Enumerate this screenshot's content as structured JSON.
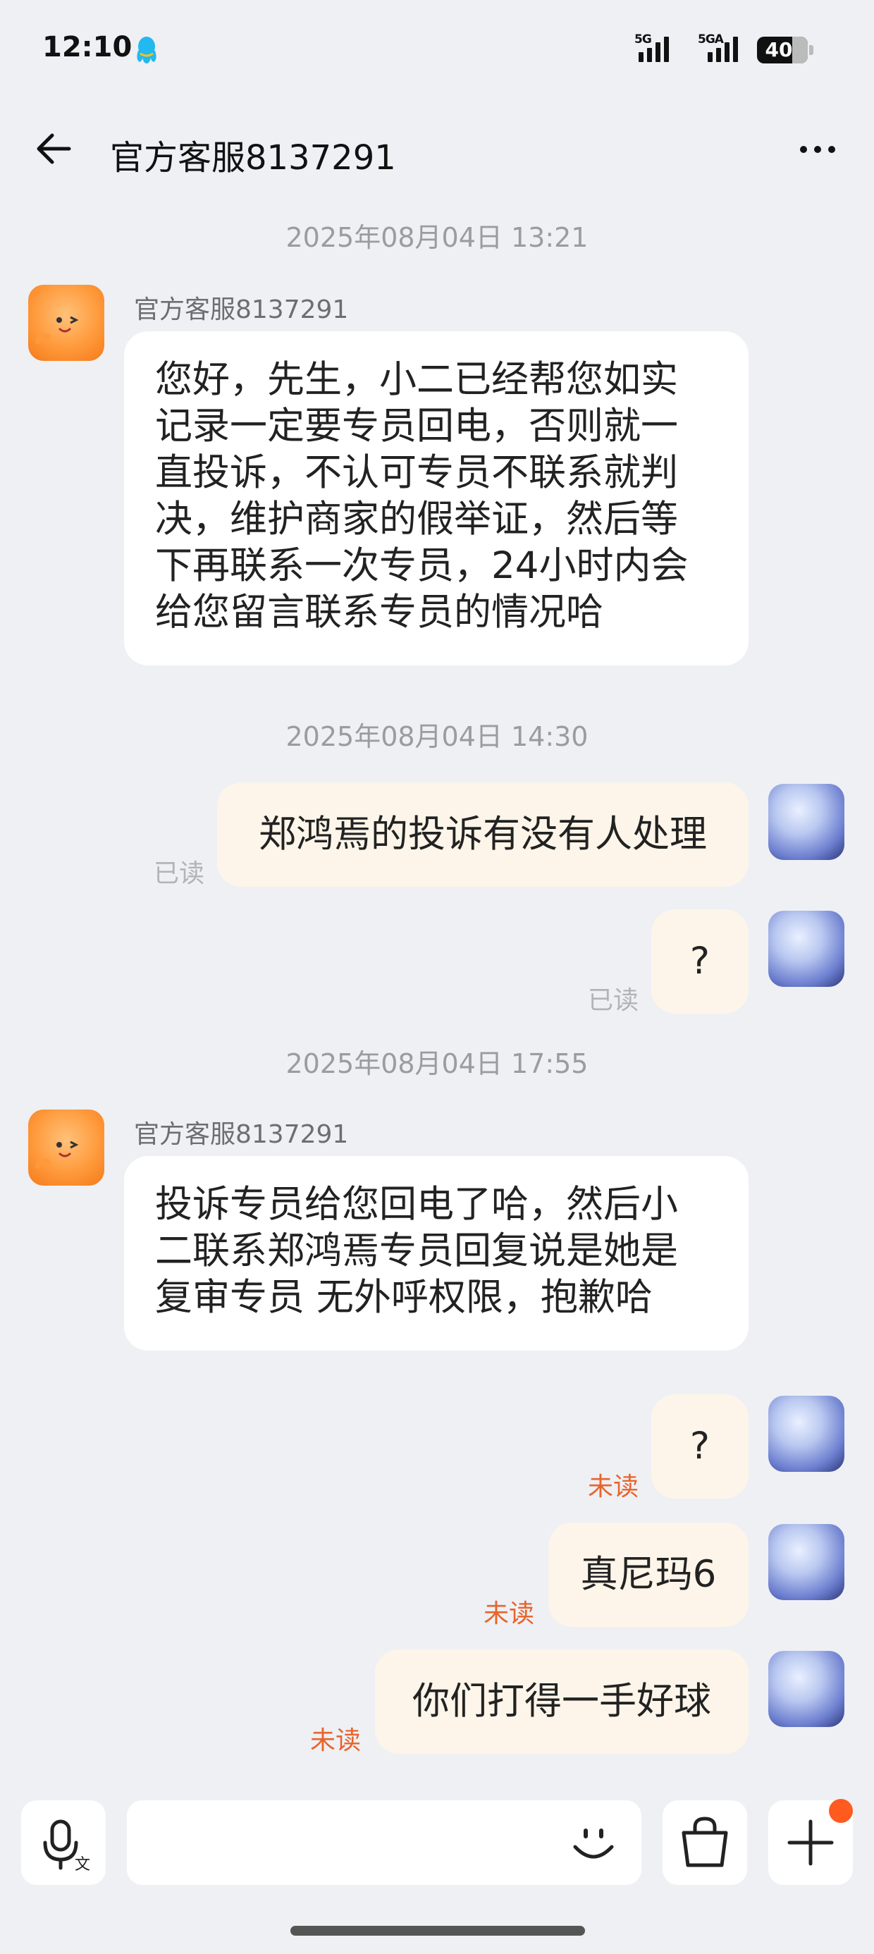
{
  "status_bar": {
    "time": "12:10",
    "signal1_label": "5G",
    "signal2_label": "5GA",
    "battery": "40",
    "icons": [
      "qq-icon",
      "signal-icon",
      "signal-icon",
      "battery-icon"
    ]
  },
  "header": {
    "title": "官方客服8137291",
    "icons": [
      "back-arrow-icon",
      "more-icon"
    ]
  },
  "messages": [
    {
      "type": "timestamp",
      "text": "2025年08月04日 13:21"
    },
    {
      "type": "incoming",
      "sender": "官方客服8137291",
      "lines": [
        "您好，先生，小二已经帮您如实",
        "记录一定要专员回电，否则就一",
        "直投诉，不认可专员不联系就判",
        "决，维护商家的假举证，然后等",
        "下再联系一次专员，24小时内会",
        "给您留言联系专员的情况哈"
      ]
    },
    {
      "type": "timestamp",
      "text": "2025年08月04日 14:30"
    },
    {
      "type": "outgoing",
      "text": "郑鸿焉的投诉有没有人处理",
      "status": "已读"
    },
    {
      "type": "outgoing",
      "text": "?",
      "status": "已读"
    },
    {
      "type": "timestamp",
      "text": "2025年08月04日 17:55"
    },
    {
      "type": "incoming",
      "sender": "官方客服8137291",
      "lines": [
        "投诉专员给您回电了哈，然后小",
        "二联系郑鸿焉专员回复说是她是",
        "复审专员 无外呼权限，抱歉哈"
      ]
    },
    {
      "type": "outgoing",
      "text": "?",
      "status": "未读"
    },
    {
      "type": "outgoing",
      "text": "真尼玛6",
      "status": "未读"
    },
    {
      "type": "outgoing",
      "text": "你们打得一手好球",
      "status": "未读"
    }
  ],
  "input_bar": {
    "icons": [
      "voice-to-text-icon",
      "emoji-icon",
      "shopping-bag-icon",
      "plus-icon"
    ],
    "badge_color": "#ff5a1f"
  },
  "colors": {
    "background": "#eef0f4",
    "incoming_bubble": "#ffffff",
    "outgoing_bubble": "#fdf5e9",
    "read_status": "#b2b4b8",
    "unread_status": "#e8642c"
  }
}
